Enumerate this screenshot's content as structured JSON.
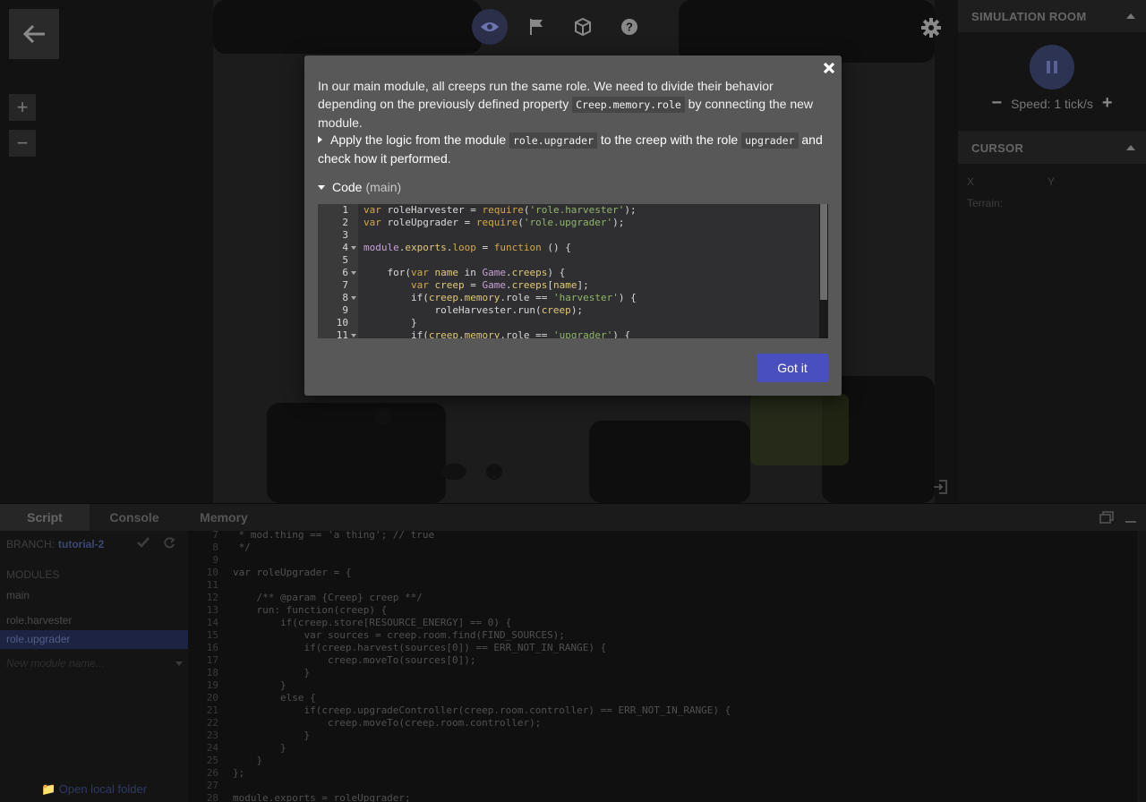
{
  "map": {
    "back_icon": "arrow-left-icon",
    "zoom_in": "+",
    "zoom_out": "−",
    "tools": [
      {
        "name": "eye-icon",
        "active": true
      },
      {
        "name": "flag-icon",
        "active": false
      },
      {
        "name": "cube-icon",
        "active": false
      },
      {
        "name": "help-icon",
        "active": false
      }
    ],
    "settings_icon": "gear-icon"
  },
  "simulation": {
    "title": "SIMULATION ROOM",
    "speed_minus": "−",
    "speed_label": "Speed: 1 tick/s",
    "speed_plus": "+"
  },
  "cursor": {
    "title": "CURSOR",
    "x_label": "X",
    "y_label": "Y",
    "terrain_label": "Terrain:"
  },
  "bottom": {
    "tabs": [
      "Script",
      "Console",
      "Memory"
    ],
    "active_tab": "Script",
    "branch_label": "BRANCH:",
    "branch_name": "tutorial-2",
    "modules_label": "MODULES",
    "modules": [
      "main",
      "role.harvester",
      "role.upgrader"
    ],
    "selected_module": "role.upgrader",
    "new_module_placeholder": "New module name...",
    "open_folder": "Open local folder"
  },
  "editor_lines": [
    {
      "n": "7",
      "code": " * mod.thing == 'a thing'; // true"
    },
    {
      "n": "8",
      "code": " */"
    },
    {
      "n": "9",
      "code": ""
    },
    {
      "n": "10",
      "code": "var roleUpgrader = {"
    },
    {
      "n": "11",
      "code": ""
    },
    {
      "n": "12",
      "code": "    /** @param {Creep} creep **/"
    },
    {
      "n": "13",
      "code": "    run: function(creep) {"
    },
    {
      "n": "14",
      "code": "        if(creep.store[RESOURCE_ENERGY] == 0) {"
    },
    {
      "n": "15",
      "code": "            var sources = creep.room.find(FIND_SOURCES);"
    },
    {
      "n": "16",
      "code": "            if(creep.harvest(sources[0]) == ERR_NOT_IN_RANGE) {"
    },
    {
      "n": "17",
      "code": "                creep.moveTo(sources[0]);"
    },
    {
      "n": "18",
      "code": "            }"
    },
    {
      "n": "19",
      "code": "        }"
    },
    {
      "n": "20",
      "code": "        else {"
    },
    {
      "n": "21",
      "code": "            if(creep.upgradeController(creep.room.controller) == ERR_NOT_IN_RANGE) {"
    },
    {
      "n": "22",
      "code": "                creep.moveTo(creep.room.controller);"
    },
    {
      "n": "23",
      "code": "            }"
    },
    {
      "n": "24",
      "code": "        }"
    },
    {
      "n": "25",
      "code": "    }"
    },
    {
      "n": "26",
      "code": "};"
    },
    {
      "n": "27",
      "code": ""
    },
    {
      "n": "28",
      "code": "module.exports = roleUpgrader;"
    }
  ],
  "modal": {
    "intro_before": "In our main module, all creeps run the same role. We need to divide their behavior depending on the previously defined property ",
    "intro_code": "Creep.memory.role",
    "intro_after": " by connecting the new module.",
    "task_before": "Apply the logic from the module ",
    "task_code1": "role.upgrader",
    "task_middle": " to the creep with the role ",
    "task_code2": "upgrader",
    "task_after": " and check how it performed.",
    "code_title": "Code",
    "code_subtitle": "(main)",
    "button": "Got it",
    "code_lines": [
      {
        "n": "1",
        "html": "<span class=\"kw\">var</span> roleHarvester = <span class=\"fn\">require</span>(<span class=\"str\">'role.harvester'</span>);"
      },
      {
        "n": "2",
        "html": "<span class=\"kw\">var</span> roleUpgrader = <span class=\"fn\">require</span>(<span class=\"str\">'role.upgrader'</span>);"
      },
      {
        "n": "3",
        "html": ""
      },
      {
        "n": "4",
        "fold": true,
        "html": "<span class=\"obj\">module</span>.<span class=\"var\">exports</span>.<span class=\"fn\">loop</span> = <span class=\"kw\">function</span> () {"
      },
      {
        "n": "5",
        "html": ""
      },
      {
        "n": "6",
        "fold": true,
        "html": "    for(<span class=\"kw\">var</span> <span class=\"var\">name</span> in <span class=\"obj\">Game</span>.<span class=\"var\">creeps</span>) {"
      },
      {
        "n": "7",
        "html": "        <span class=\"kw\">var</span> <span class=\"var\">creep</span> = <span class=\"obj\">Game</span>.<span class=\"var\">creeps</span>[<span class=\"var\">name</span>];"
      },
      {
        "n": "8",
        "fold": true,
        "html": "        if(<span class=\"var\">creep</span>.<span class=\"var\">memory</span>.role == <span class=\"str\">'harvester'</span>) {"
      },
      {
        "n": "9",
        "html": "            roleHarvester.run(<span class=\"var\">creep</span>);"
      },
      {
        "n": "10",
        "html": "        }"
      },
      {
        "n": "11",
        "fold": true,
        "html": "        if(<span class=\"var\">creep</span>.<span class=\"var\">memory</span>.role == <span class=\"str\">'upgrader'</span>) {"
      }
    ]
  }
}
